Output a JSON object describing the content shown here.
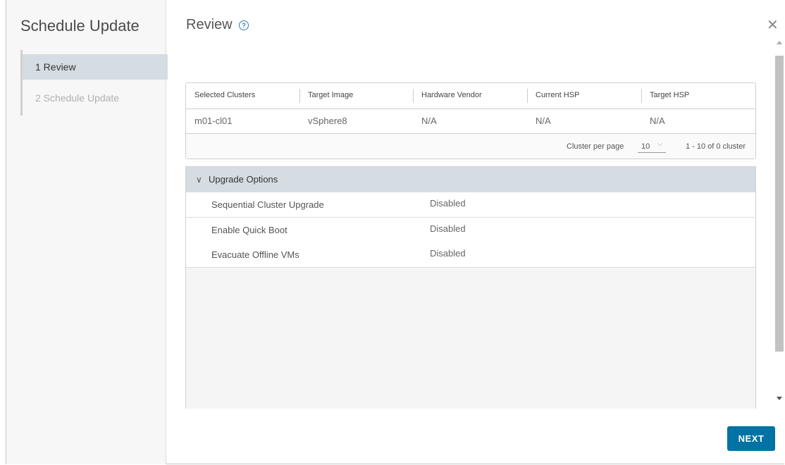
{
  "wizard": {
    "title": "Schedule Update",
    "steps": [
      {
        "label": "1  Review",
        "active": true
      },
      {
        "label": "2  Schedule Update",
        "active": false
      }
    ]
  },
  "page": {
    "title": "Review",
    "help_icon": "help-circle-icon",
    "close_icon": "close-icon"
  },
  "clusters_table": {
    "columns": [
      "Selected Clusters",
      "Target Image",
      "Hardware Vendor",
      "Current HSP",
      "Target HSP"
    ],
    "rows": [
      [
        "m01-cl01",
        "vSphere8",
        "N/A",
        "N/A",
        "N/A"
      ]
    ],
    "footer": {
      "per_page_label": "Cluster per page",
      "per_page_value": "10",
      "range_text": "1 - 10 of 0 cluster"
    }
  },
  "upgrade_options": {
    "title": "Upgrade Options",
    "rows": [
      {
        "label": "Sequential Cluster Upgrade",
        "value": "Disabled"
      },
      {
        "label": "Enable Quick Boot",
        "value": "Disabled"
      },
      {
        "label": "Evacuate Offline VMs",
        "value": "Disabled"
      }
    ]
  },
  "footer": {
    "next_label": "NEXT"
  },
  "colors": {
    "primary_button": "#0072a3",
    "active_step": "#d5dde3",
    "link": "#2a7fbf"
  }
}
